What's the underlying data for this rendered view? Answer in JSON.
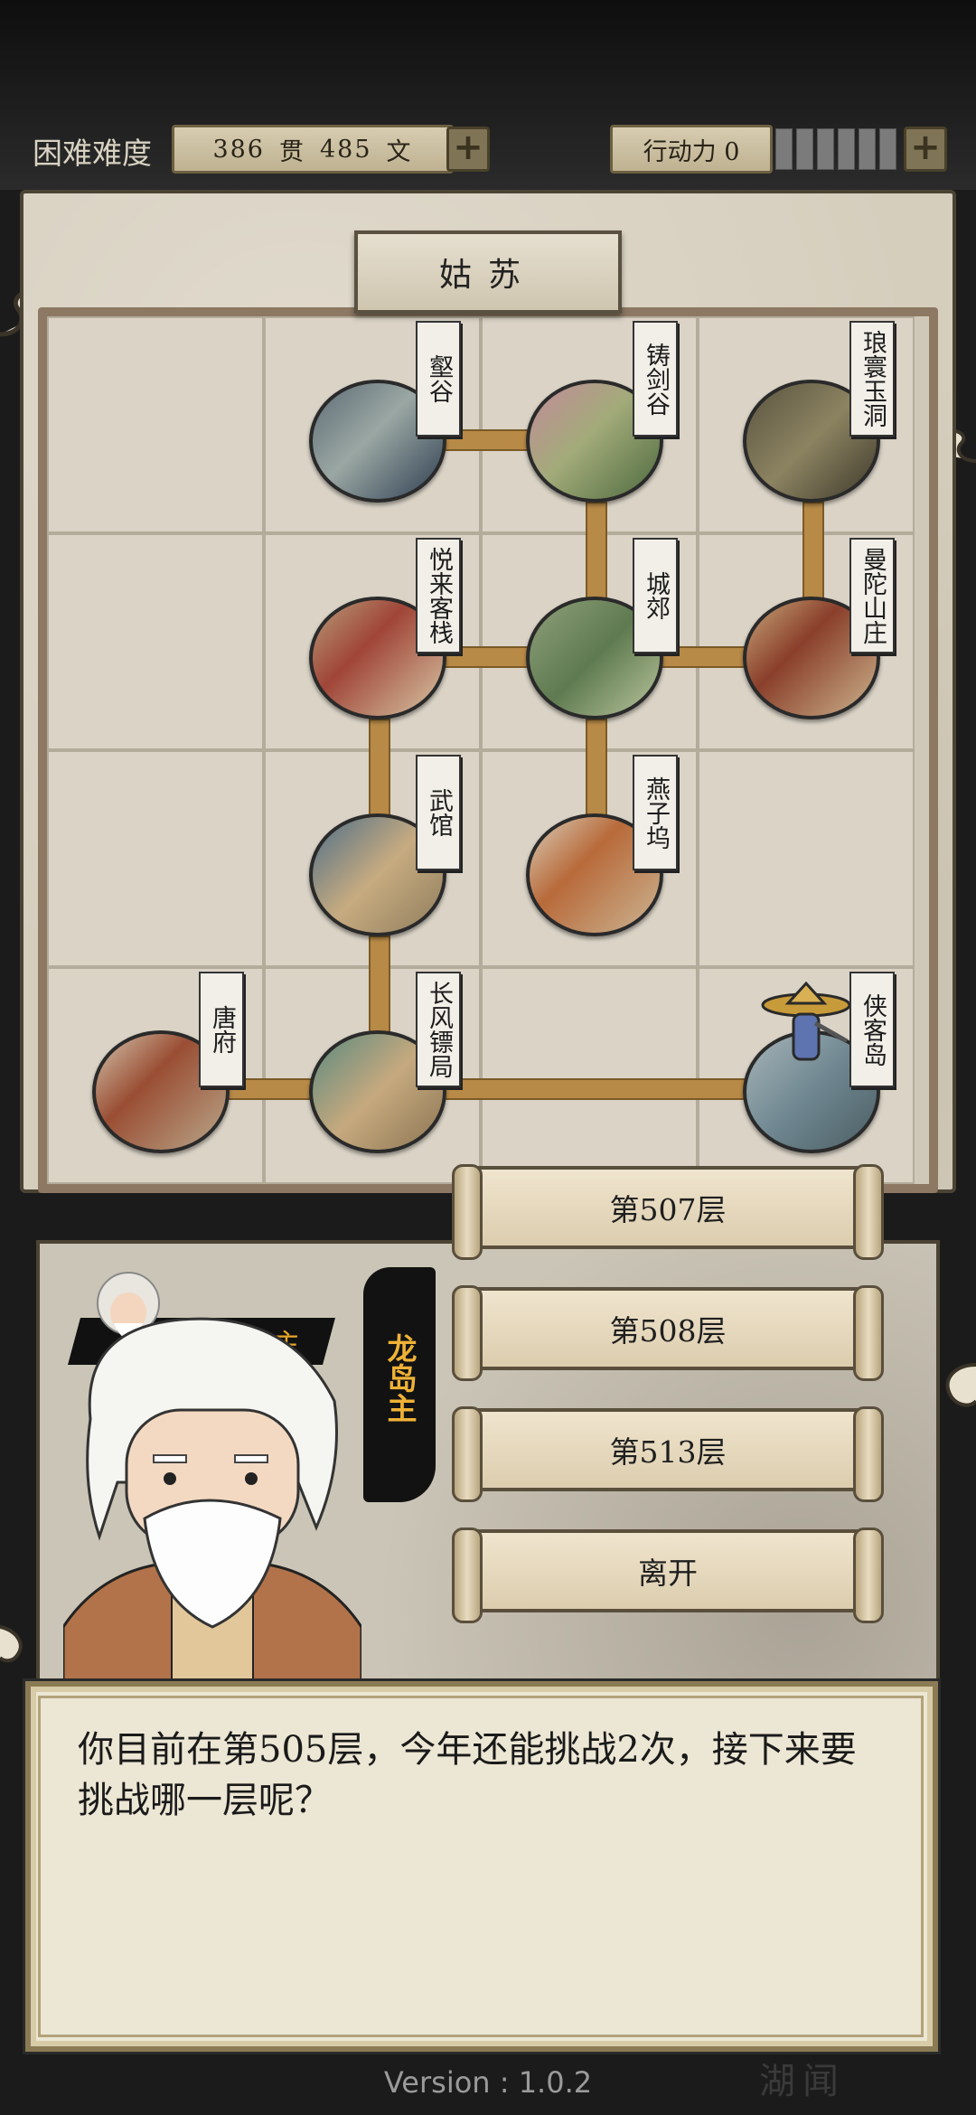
{
  "header": {
    "difficulty": "困难难度",
    "money_guan": "386",
    "guan_unit": "贯",
    "money_wen": "485",
    "wen_unit": "文",
    "action_label": "行动力 0",
    "plus_label": "+"
  },
  "map": {
    "title": "姑苏",
    "locations": [
      {
        "name": "壑谷"
      },
      {
        "name": "铸剑谷"
      },
      {
        "name": "琅寰玉洞"
      },
      {
        "name": "悦来客栈"
      },
      {
        "name": "城郊"
      },
      {
        "name": "曼陀山庄"
      },
      {
        "name": "武馆"
      },
      {
        "name": "燕子坞"
      },
      {
        "name": "唐府"
      },
      {
        "name": "长风镖局"
      },
      {
        "name": "侠客岛"
      }
    ]
  },
  "floors": {
    "options": [
      "第507层",
      "第508层",
      "第513层",
      "离开"
    ]
  },
  "npc": {
    "small_tag": "主",
    "speaker": "龙岛主"
  },
  "dialog": {
    "text": "你目前在第505层，今年还能挑战2次，接下来要挑战哪一层呢？"
  },
  "footer": {
    "version": "Version : 1.0.2",
    "corner": "湖闻"
  },
  "colors": {
    "road": "#b88a47",
    "speaker_gold": "#efb236",
    "parchment": "#d6cebd"
  }
}
